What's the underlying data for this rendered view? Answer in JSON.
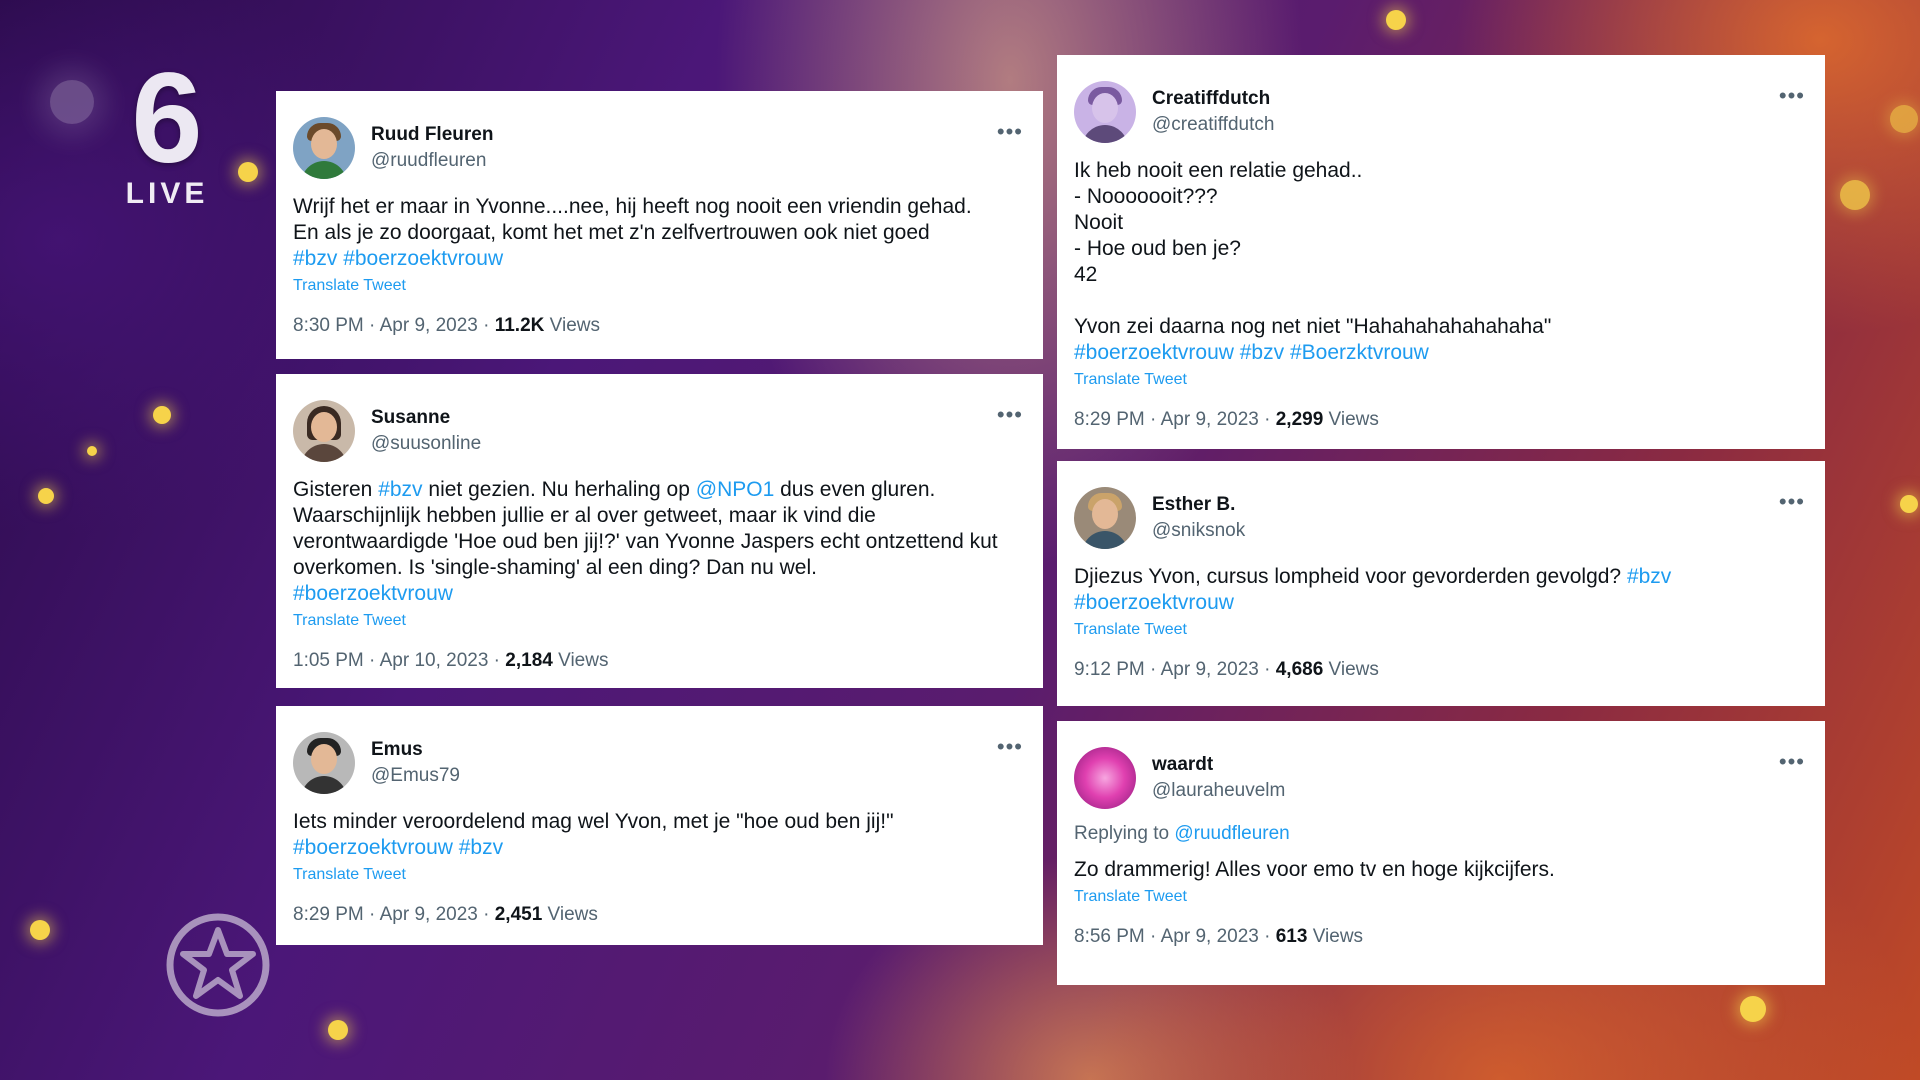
{
  "channel": {
    "logo_number": "6",
    "logo_text": "LIVE"
  },
  "tweets": [
    {
      "display_name": "Ruud Fleuren",
      "handle": "@ruudfleuren",
      "lines": [
        "Wrijf het er maar in Yvonne....nee, hij heeft nog nooit een vriendin gehad.",
        "En als je zo doorgaat, komt het met z'n zelfvertrouwen ook niet goed"
      ],
      "hashtags": "#bzv #boerzoektvrouw",
      "translate": "Translate Tweet",
      "time": "8:30 PM · Apr 9, 2023 · ",
      "views": "11.2K",
      "views_label": " Views"
    },
    {
      "display_name": "Susanne",
      "handle": "@suusonline",
      "text_pre": "Gisteren ",
      "text_tag1": "#bzv",
      "text_mid": " niet gezien. Nu herhaling op ",
      "text_mention": "@NPO1",
      "text_post": " dus even gluren. Waarschijnlijk hebben jullie er al over getweet, maar ik vind die verontwaardigde 'Hoe oud ben jij!?' van Yvonne Jaspers echt ontzettend kut overkomen. Is 'single-shaming' al een ding? Dan nu wel.",
      "hashtags": "#boerzoektvrouw",
      "translate": "Translate Tweet",
      "time": "1:05 PM · Apr 10, 2023 · ",
      "views": "2,184",
      "views_label": " Views"
    },
    {
      "display_name": "Emus",
      "handle": "@Emus79",
      "lines": [
        "Iets minder veroordelend mag wel Yvon, met je \"hoe oud ben jij!\""
      ],
      "hashtags": "#boerzoektvrouw #bzv",
      "translate": "Translate Tweet",
      "time": "8:29 PM · Apr 9, 2023 · ",
      "views": "2,451",
      "views_label": " Views"
    },
    {
      "display_name": "Creatiffdutch",
      "handle": "@creatiffdutch",
      "lines": [
        "Ik heb nooit een relatie gehad..",
        "- Nooooooit???",
        "Nooit",
        "- Hoe oud ben je?",
        "42",
        "",
        "Yvon zei daarna nog net niet \"Hahahahahahahaha\""
      ],
      "hashtags": "#boerzoektvrouw #bzv #Boerzktvrouw",
      "translate": "Translate Tweet",
      "time": "8:29 PM · Apr 9, 2023 · ",
      "views": "2,299",
      "views_label": " Views"
    },
    {
      "display_name": "Esther B.",
      "handle": "@sniksnok",
      "text_pre": "Djiezus Yvon, cursus lompheid voor gevorderden gevolgd? ",
      "text_tag1": "#bzv",
      "hashtags": "#boerzoektvrouw",
      "translate": "Translate Tweet",
      "time": "9:12 PM · Apr 9, 2023 · ",
      "views": "4,686",
      "views_label": " Views"
    },
    {
      "display_name": "waardt",
      "handle": "@lauraheuvelm",
      "replying_label": "Replying to ",
      "replying_to": "@ruudfleuren",
      "lines": [
        "Zo drammerig! Alles voor emo tv en hoge kijkcijfers."
      ],
      "translate": "Translate Tweet",
      "time": "8:56 PM · Apr 9, 2023 · ",
      "views": "613",
      "views_label": " Views"
    }
  ],
  "colors": {
    "link": "#1d9bf0",
    "muted": "#536471",
    "bokeh": "#f6d34a"
  },
  "icons": [
    "more-options-icon",
    "star-badge-icon",
    "avatar"
  ]
}
